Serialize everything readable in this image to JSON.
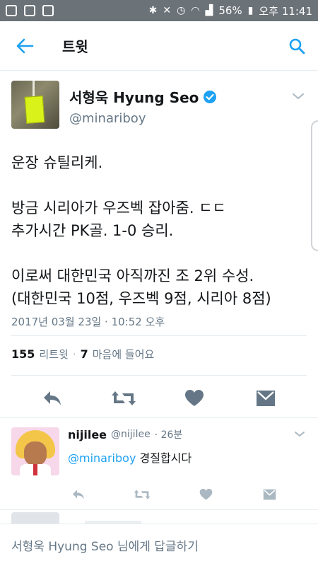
{
  "status_bar": {
    "battery": "56%",
    "time": "오후 11:41"
  },
  "topbar": {
    "title": "트윗"
  },
  "tweet": {
    "display_name": "서형욱 Hyung Seo",
    "handle": "@minariboy",
    "text": "운장 슈틸리케.\n\n방금 시리아가 우즈벡 잡아줌. ㄷㄷ\n추가시간 PK골. 1-0 승리.\n\n이로써 대한민국 아직까진 조 2위 수성.\n(대한민국 10점, 우즈벡 9점, 시리아 8점)",
    "timestamp": "2017년 03월 23일 · 10:52 오후",
    "retweet_count": "155",
    "retweet_label": "리트윗",
    "like_count": "7",
    "like_label": "마음에 들어요"
  },
  "reply": {
    "name": "nijilee",
    "handle": "@nijilee",
    "time": "· 26분",
    "mention": "@minariboy",
    "text": " 경질합시다"
  },
  "reply_bar": {
    "placeholder": "서형욱 Hyung Seo 님에게 답글하기"
  },
  "colors": {
    "accent": "#1da1f2",
    "verified": "#1da1f2",
    "icon_gray": "#657786",
    "status_bar": "#6b7278"
  },
  "icons": [
    "back-arrow-icon",
    "search-icon",
    "verified-badge-icon",
    "chevron-down-icon",
    "reply-icon",
    "retweet-icon",
    "heart-icon",
    "direct-message-icon"
  ]
}
